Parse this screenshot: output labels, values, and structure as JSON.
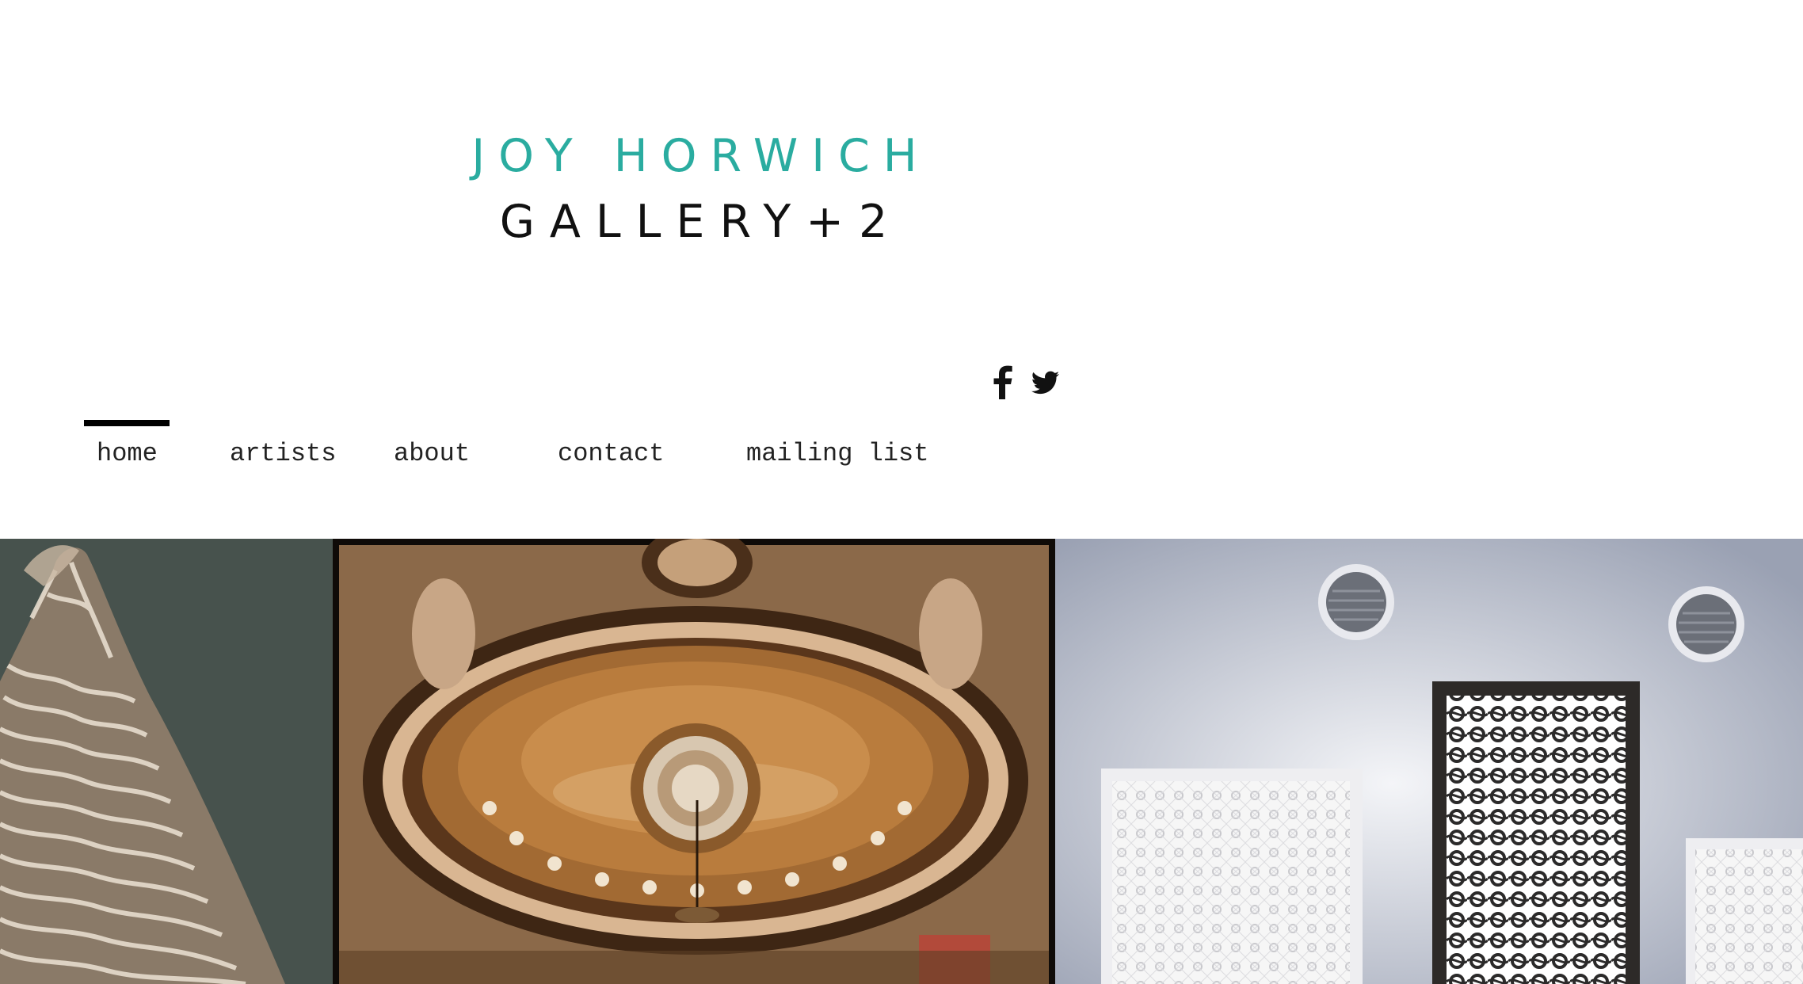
{
  "header": {
    "logo_line1": "JOY HORWICH",
    "logo_line2": "GALLERY+2",
    "accent_color": "#2aaca0"
  },
  "social": {
    "icons": [
      "facebook-icon",
      "twitter-icon"
    ]
  },
  "nav": {
    "items": [
      {
        "label": "home",
        "active": true
      },
      {
        "label": "artists",
        "active": false
      },
      {
        "label": "about",
        "active": false
      },
      {
        "label": "contact",
        "active": false
      },
      {
        "label": "mailing list",
        "active": false
      }
    ]
  },
  "gallery": {
    "images": [
      {
        "subject": "paper-sculpture"
      },
      {
        "subject": "ornate-ceiling-dome"
      },
      {
        "subject": "gallery-wall-papercuts"
      }
    ]
  }
}
